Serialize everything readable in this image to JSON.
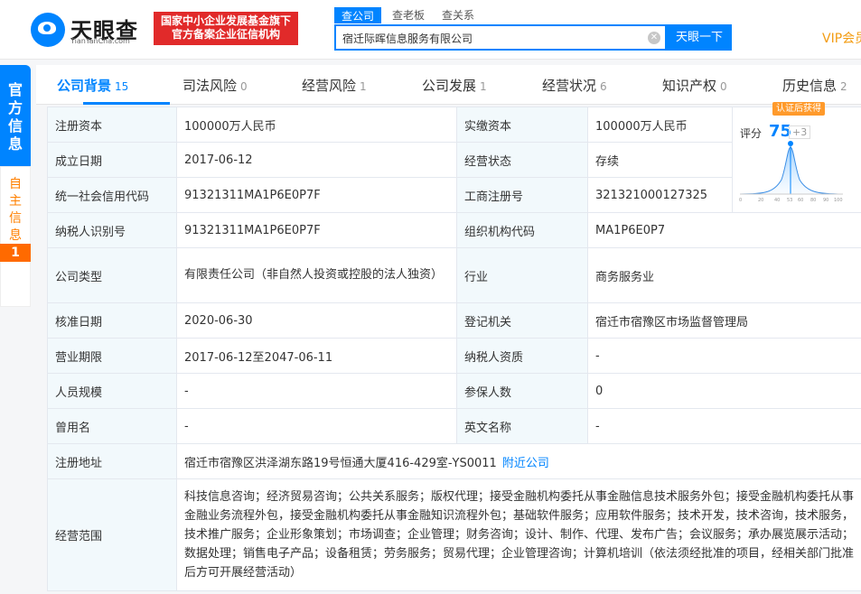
{
  "header": {
    "logo_text": "天眼查",
    "logo_sub": "TianYanCha.com",
    "badge_line1": "国家中小企业发展基金旗下",
    "badge_line2": "官方备案企业征信机构",
    "search_tabs": [
      "查公司",
      "查老板",
      "查关系"
    ],
    "search_value": "宿迁际晖信息服务有限公司",
    "search_button": "天眼一下",
    "vip": "VIP会员"
  },
  "sidebar": {
    "official": "官方信息",
    "self": "自主信息",
    "self_count": "1"
  },
  "tabs": [
    {
      "label": "公司背景",
      "count": "15"
    },
    {
      "label": "司法风险",
      "count": "0"
    },
    {
      "label": "经营风险",
      "count": "1"
    },
    {
      "label": "公司发展",
      "count": "1"
    },
    {
      "label": "经营状况",
      "count": "6"
    },
    {
      "label": "知识产权",
      "count": "0"
    },
    {
      "label": "历史信息",
      "count": "2"
    }
  ],
  "score": {
    "tag": "认证后获得",
    "label": "评分",
    "value": "75",
    "plus": "+3",
    "axis_ticks": [
      "0",
      "20",
      "40",
      "53",
      "60",
      "80",
      "90",
      "100"
    ]
  },
  "info": {
    "reg_capital_label": "注册资本",
    "reg_capital": "100000万人民币",
    "paid_capital_label": "实缴资本",
    "paid_capital": "100000万人民币",
    "found_date_label": "成立日期",
    "found_date": "2017-06-12",
    "status_label": "经营状态",
    "status": "存续",
    "credit_code_label": "统一社会信用代码",
    "credit_code": "91321311MA1P6E0P7F",
    "reg_no_label": "工商注册号",
    "reg_no": "321321000127325",
    "taxpayer_id_label": "纳税人识别号",
    "taxpayer_id": "91321311MA1P6E0P7F",
    "org_code_label": "组织机构代码",
    "org_code": "MA1P6E0P7",
    "company_type_label": "公司类型",
    "company_type": "有限责任公司（非自然人投资或控股的法人独资）",
    "industry_label": "行业",
    "industry": "商务服务业",
    "approval_date_label": "核准日期",
    "approval_date": "2020-06-30",
    "authority_label": "登记机关",
    "authority": "宿迁市宿豫区市场监督管理局",
    "term_label": "营业期限",
    "term": "2017-06-12至2047-06-11",
    "taxpayer_qual_label": "纳税人资质",
    "taxpayer_qual": "-",
    "staff_label": "人员规模",
    "staff": "-",
    "insured_label": "参保人数",
    "insured": "0",
    "former_name_label": "曾用名",
    "former_name": "-",
    "english_name_label": "英文名称",
    "english_name": "-",
    "address_label": "注册地址",
    "address": "宿迁市宿豫区洪泽湖东路19号恒通大厦416-429室-YS0011",
    "nearby_link": "附近公司",
    "scope_label": "经营范围",
    "scope": "科技信息咨询；经济贸易咨询；公共关系服务；版权代理；接受金融机构委托从事金融信息技术服务外包；接受金融机构委托从事金融业务流程外包，接受金融机构委托从事金融知识流程外包；基础软件服务；应用软件服务；技术开发，技术咨询，技术服务，技术推广服务；企业形象策划；市场调查；企业管理；财务咨询；设计、制作、代理、发布广告；会议服务；承办展览展示活动；数据处理；销售电子产品；设备租赁；劳务服务；贸易代理；企业管理咨询；计算机培训（依法须经批准的项目，经相关部门批准后方可开展经营活动）"
  }
}
